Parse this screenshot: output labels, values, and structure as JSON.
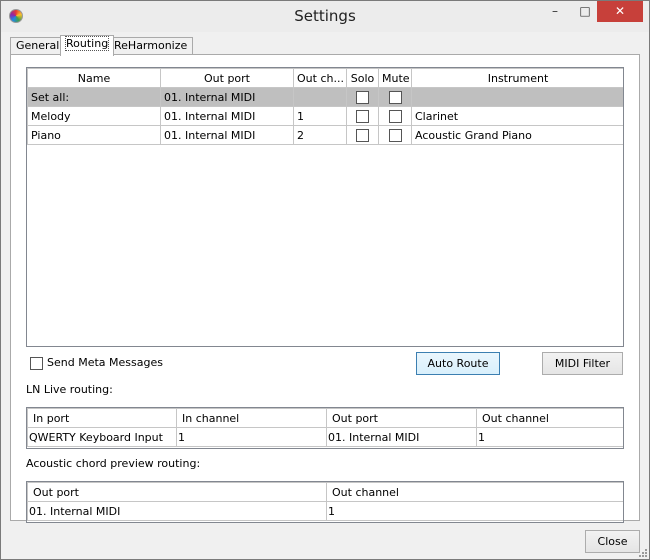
{
  "window": {
    "title": "Settings",
    "controls": {
      "minimize": "–",
      "maximize": "□",
      "close": "✕"
    }
  },
  "tabs": [
    {
      "label": "General",
      "active": false
    },
    {
      "label": "Routing",
      "active": true
    },
    {
      "label": "ReHarmonize",
      "active": false
    }
  ],
  "routing_table": {
    "columns": [
      "Name",
      "Out port",
      "Out ch...",
      "Solo",
      "Mute",
      "Instrument"
    ],
    "rows": [
      {
        "name": "Set all:",
        "out_port": "01. Internal MIDI",
        "out_channel": "",
        "solo": false,
        "mute": false,
        "instrument": "",
        "highlighted": true
      },
      {
        "name": "Melody",
        "out_port": "01. Internal MIDI",
        "out_channel": "1",
        "solo": false,
        "mute": false,
        "instrument": "Clarinet"
      },
      {
        "name": "Piano",
        "out_port": "01. Internal MIDI",
        "out_channel": "2",
        "solo": false,
        "mute": false,
        "instrument": "Acoustic Grand Piano"
      }
    ]
  },
  "send_meta": {
    "label": "Send Meta Messages",
    "checked": false
  },
  "buttons": {
    "auto_route": "Auto Route",
    "midi_filter": "MIDI Filter",
    "close": "Close"
  },
  "live_routing": {
    "label": "LN Live routing:",
    "columns": [
      "In port",
      "In channel",
      "Out port",
      "Out channel"
    ],
    "rows": [
      {
        "in_port": "QWERTY Keyboard Input",
        "in_channel": "1",
        "out_port": "01. Internal MIDI",
        "out_channel": "1"
      }
    ]
  },
  "chord_preview": {
    "label": "Acoustic chord preview routing:",
    "columns": [
      "Out port",
      "Out channel"
    ],
    "rows": [
      {
        "out_port": "01. Internal MIDI",
        "out_channel": "1"
      }
    ]
  },
  "colors": {
    "close_button": "#c7403a",
    "selected_row": "#bfbfbf",
    "default_button_border": "#3c7fb1"
  }
}
